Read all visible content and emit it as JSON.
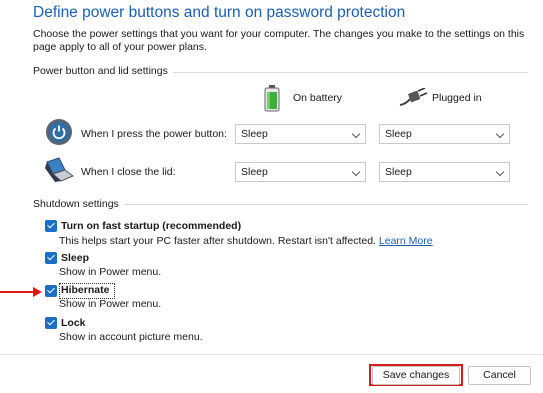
{
  "header": {
    "title": "Define power buttons and turn on password protection",
    "intro": "Choose the power settings that you want for your computer. The changes you make to the settings on this page apply to all of your power plans."
  },
  "power_group": {
    "label": "Power button and lid settings",
    "col_battery": "On battery",
    "col_plugged": "Plugged in",
    "rows": [
      {
        "label": "When I press the power button:",
        "battery": "Sleep",
        "plugged": "Sleep",
        "icon": "power-button-icon"
      },
      {
        "label": "When I close the lid:",
        "battery": "Sleep",
        "plugged": "Sleep",
        "icon": "laptop-lid-icon"
      }
    ]
  },
  "shutdown_group": {
    "label": "Shutdown settings",
    "items": [
      {
        "label": "Turn on fast startup (recommended)",
        "desc": "This helps start your PC faster after shutdown. Restart isn't affected.",
        "link": "Learn More",
        "checked": true
      },
      {
        "label": "Sleep",
        "desc": "Show in Power menu.",
        "checked": true
      },
      {
        "label": "Hibernate",
        "desc": "Show in Power menu.",
        "checked": true
      },
      {
        "label": "Lock",
        "desc": "Show in account picture menu.",
        "checked": true
      }
    ]
  },
  "footer": {
    "save": "Save changes",
    "cancel": "Cancel"
  },
  "colors": {
    "accent": "#1a6fc4",
    "title": "#1a5fb4",
    "annotation": "#d81b1b"
  }
}
